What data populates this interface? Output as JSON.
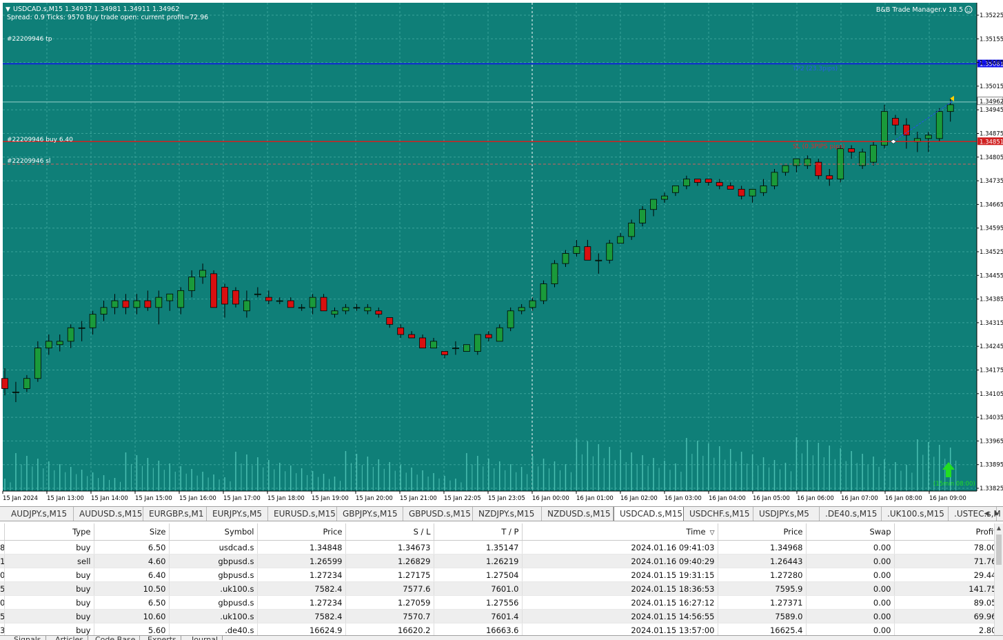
{
  "window": {
    "symbol_header": "USDCAD.s,M15  1.34937 1.34981 1.34911 1.34962",
    "info_line": "Spread: 0.9   Ticks: 9570   Buy trade open: current profit=72.96",
    "expert_label": "B&B Trade Manager.v 18.5"
  },
  "colors": {
    "chart_bg": "#0f7f78",
    "bull": "#1a9a3a",
    "bear": "#d81010",
    "tp_line": "#1010ee",
    "sl_line": "#d02020",
    "grid": "#3aa39a",
    "volume": "#4bbfb2"
  },
  "chart_labels": {
    "tp_order": "#22209946 tp",
    "buy_order": "#22209946 buy 6.40",
    "sl_order": "#22209946 sl",
    "tp_text": "TP2 (23.3pips)",
    "sl_text": "SL (0.3PIPS pips)",
    "countdown": "(15min 08:00)"
  },
  "chart_data": {
    "type": "candlestick",
    "price_axis_ticks": [
      "1.35225",
      "1.35155",
      "1.35085",
      "1.35015",
      "1.34945",
      "1.34875",
      "1.34805",
      "1.34735",
      "1.34665",
      "1.34595",
      "1.34525",
      "1.34455",
      "1.34385",
      "1.34315",
      "1.34245",
      "1.34175",
      "1.34105",
      "1.34035",
      "1.33965",
      "1.33895",
      "1.33825"
    ],
    "price_range": [
      1.3381,
      1.3527
    ],
    "time_axis_labels": [
      "15 Jan 2024",
      "15 Jan 13:00",
      "15 Jan 14:00",
      "15 Jan 15:00",
      "15 Jan 16:00",
      "15 Jan 17:00",
      "15 Jan 18:00",
      "15 Jan 19:00",
      "15 Jan 20:00",
      "15 Jan 21:00",
      "15 Jan 22:05",
      "15 Jan 23:05",
      "16 Jan 00:00",
      "16 Jan 01:00",
      "16 Jan 02:00",
      "16 Jan 03:00",
      "16 Jan 04:00",
      "16 Jan 05:00",
      "16 Jan 06:00",
      "16 Jan 07:00",
      "16 Jan 08:00",
      "16 Jan 09:00"
    ],
    "tp_price": 1.35081,
    "tp_price_label": "1.35081",
    "current_price": 1.34962,
    "current_price_label": "1.34962",
    "sl_price": 1.34851,
    "sl_price_label": "1.34851",
    "candles": [
      [
        1.3415,
        1.3418,
        1.341,
        1.3412
      ],
      [
        1.3411,
        1.3414,
        1.3408,
        1.3411
      ],
      [
        1.3412,
        1.3416,
        1.3411,
        1.3415
      ],
      [
        1.3415,
        1.3426,
        1.3414,
        1.3424
      ],
      [
        1.3424,
        1.3428,
        1.3422,
        1.3426
      ],
      [
        1.3425,
        1.3428,
        1.3423,
        1.3426
      ],
      [
        1.3426,
        1.3431,
        1.3424,
        1.343
      ],
      [
        1.343,
        1.3432,
        1.3426,
        1.343
      ],
      [
        1.343,
        1.3435,
        1.3428,
        1.3434
      ],
      [
        1.3434,
        1.3438,
        1.3432,
        1.3436
      ],
      [
        1.3436,
        1.344,
        1.3434,
        1.3438
      ],
      [
        1.3438,
        1.344,
        1.3434,
        1.3436
      ],
      [
        1.3436,
        1.344,
        1.3434,
        1.3438
      ],
      [
        1.3438,
        1.3441,
        1.3435,
        1.3436
      ],
      [
        1.3436,
        1.3441,
        1.3431,
        1.3439
      ],
      [
        1.3438,
        1.344,
        1.3435,
        1.344
      ],
      [
        1.3436,
        1.3442,
        1.3434,
        1.3441
      ],
      [
        1.3441,
        1.3447,
        1.3439,
        1.3445
      ],
      [
        1.3445,
        1.3449,
        1.3443,
        1.3447
      ],
      [
        1.3446,
        1.3447,
        1.3436,
        1.3436
      ],
      [
        1.3442,
        1.3443,
        1.3433,
        1.3437
      ],
      [
        1.3441,
        1.3442,
        1.3436,
        1.3437
      ],
      [
        1.3435,
        1.3441,
        1.3433,
        1.3438
      ],
      [
        1.344,
        1.3442,
        1.3439,
        1.344
      ],
      [
        1.3439,
        1.3441,
        1.3437,
        1.3438
      ],
      [
        1.3438,
        1.3439,
        1.3437,
        1.3438
      ],
      [
        1.3438,
        1.3439,
        1.3436,
        1.3436
      ],
      [
        1.3436,
        1.3437,
        1.3435,
        1.3436
      ],
      [
        1.3436,
        1.344,
        1.3434,
        1.3439
      ],
      [
        1.3439,
        1.344,
        1.3435,
        1.3435
      ],
      [
        1.3434,
        1.3436,
        1.3433,
        1.3435
      ],
      [
        1.3435,
        1.3437,
        1.3434,
        1.3436
      ],
      [
        1.3436,
        1.3437,
        1.3435,
        1.3436
      ],
      [
        1.3435,
        1.3437,
        1.3434,
        1.3436
      ],
      [
        1.3435,
        1.3436,
        1.3433,
        1.3434
      ],
      [
        1.3433,
        1.3433,
        1.343,
        1.3431
      ],
      [
        1.343,
        1.3431,
        1.3427,
        1.3428
      ],
      [
        1.3428,
        1.3429,
        1.3427,
        1.3427
      ],
      [
        1.3427,
        1.3428,
        1.3424,
        1.3424
      ],
      [
        1.3424,
        1.3427,
        1.3424,
        1.3426
      ],
      [
        1.3423,
        1.3423,
        1.3421,
        1.3422
      ],
      [
        1.3424,
        1.3426,
        1.3422,
        1.3424
      ],
      [
        1.3423,
        1.3425,
        1.3423,
        1.3425
      ],
      [
        1.3423,
        1.3428,
        1.3422,
        1.3428
      ],
      [
        1.3428,
        1.3429,
        1.3426,
        1.3427
      ],
      [
        1.3426,
        1.3431,
        1.3426,
        1.343
      ],
      [
        1.343,
        1.3436,
        1.3429,
        1.3435
      ],
      [
        1.3435,
        1.3437,
        1.3434,
        1.3436
      ],
      [
        1.3436,
        1.3439,
        1.3435,
        1.3438
      ],
      [
        1.3438,
        1.3444,
        1.3437,
        1.3443
      ],
      [
        1.3443,
        1.345,
        1.3442,
        1.3449
      ],
      [
        1.3449,
        1.3453,
        1.3448,
        1.3452
      ],
      [
        1.3452,
        1.3456,
        1.3451,
        1.3454
      ],
      [
        1.3454,
        1.3456,
        1.345,
        1.345
      ],
      [
        1.345,
        1.3452,
        1.3446,
        1.345
      ],
      [
        1.345,
        1.3456,
        1.3449,
        1.3455
      ],
      [
        1.3455,
        1.3458,
        1.3455,
        1.3457
      ],
      [
        1.3457,
        1.3462,
        1.3456,
        1.3461
      ],
      [
        1.3461,
        1.3466,
        1.346,
        1.3465
      ],
      [
        1.3465,
        1.3468,
        1.3463,
        1.3468
      ],
      [
        1.3468,
        1.347,
        1.3467,
        1.3469
      ],
      [
        1.347,
        1.3472,
        1.3469,
        1.3472
      ],
      [
        1.3472,
        1.3475,
        1.3471,
        1.3474
      ],
      [
        1.3474,
        1.3474,
        1.3472,
        1.3473
      ],
      [
        1.3474,
        1.3474,
        1.3472,
        1.3473
      ],
      [
        1.3473,
        1.3474,
        1.3471,
        1.3472
      ],
      [
        1.3472,
        1.3473,
        1.3471,
        1.3471
      ],
      [
        1.3471,
        1.3472,
        1.3468,
        1.3469
      ],
      [
        1.3469,
        1.3471,
        1.3467,
        1.3471
      ],
      [
        1.347,
        1.3474,
        1.3469,
        1.3472
      ],
      [
        1.3472,
        1.3477,
        1.3471,
        1.3476
      ],
      [
        1.3476,
        1.3478,
        1.3475,
        1.3478
      ],
      [
        1.3478,
        1.348,
        1.3476,
        1.348
      ],
      [
        1.3478,
        1.3481,
        1.3477,
        1.348
      ],
      [
        1.3479,
        1.348,
        1.3474,
        1.3475
      ],
      [
        1.3475,
        1.3477,
        1.3472,
        1.3474
      ],
      [
        1.3474,
        1.3484,
        1.3473,
        1.3483
      ],
      [
        1.3483,
        1.3484,
        1.348,
        1.3482
      ],
      [
        1.3478,
        1.3483,
        1.3477,
        1.3482
      ],
      [
        1.3479,
        1.3485,
        1.3478,
        1.3484
      ],
      [
        1.3484,
        1.3496,
        1.3483,
        1.3494
      ],
      [
        1.3492,
        1.3493,
        1.3487,
        1.349
      ],
      [
        1.349,
        1.3492,
        1.3483,
        1.3487
      ],
      [
        1.3485,
        1.3488,
        1.3482,
        1.3486
      ],
      [
        1.3486,
        1.3488,
        1.3482,
        1.3487
      ],
      [
        1.3486,
        1.3495,
        1.3485,
        1.3494
      ],
      [
        1.3494,
        1.3498,
        1.3491,
        1.3496
      ]
    ],
    "grid": true
  },
  "symbol_tabs": [
    "AUDJPY.s,M15",
    "AUDUSD.s,M15",
    "EURGBP.s,M1",
    "EURJPY.s,M5",
    "EURUSD.s,M15",
    "GBPJPY.s,M15",
    "GBPUSD.s,M15",
    "NZDJPY.s,M15",
    "NZDUSD.s,M15",
    "USDCAD.s,M15",
    "USDCHF.s,M15",
    "USDJPY.s,M5",
    ".DE40.s,M15",
    ".UK100.s,M15",
    ".USTEC.s,M"
  ],
  "active_tab": "USDCAD.s,M15",
  "tab_scroll": {
    "left": "◀",
    "right": "▶"
  },
  "trades": {
    "columns": [
      "Type",
      "Size",
      "Symbol",
      "Price",
      "S / L",
      "T / P",
      "Time",
      "Price",
      "Swap",
      "Profit"
    ],
    "sort_indicator": "▽",
    "rows": [
      {
        "id": "8",
        "type": "buy",
        "size": "6.50",
        "symbol": "usdcad.s",
        "price": "1.34848",
        "sl": "1.34673",
        "tp": "1.35147",
        "time": "2024.01.16 09:41:03",
        "cur": "1.34968",
        "swap": "0.00",
        "profit": "78.00"
      },
      {
        "id": "1",
        "type": "sell",
        "size": "4.60",
        "symbol": "gbpusd.s",
        "price": "1.26599",
        "sl": "1.26829",
        "tp": "1.26219",
        "time": "2024.01.16 09:40:29",
        "cur": "1.26443",
        "swap": "0.00",
        "profit": "71.76"
      },
      {
        "id": "0",
        "type": "buy",
        "size": "6.40",
        "symbol": "gbpusd.s",
        "price": "1.27234",
        "sl": "1.27175",
        "tp": "1.27504",
        "time": "2024.01.15 19:31:15",
        "cur": "1.27280",
        "swap": "0.00",
        "profit": "29.44"
      },
      {
        "id": "5",
        "type": "buy",
        "size": "10.50",
        "symbol": ".uk100.s",
        "price": "7582.4",
        "sl": "7577.6",
        "tp": "7601.0",
        "time": "2024.01.15 18:36:53",
        "cur": "7595.9",
        "swap": "0.00",
        "profit": "141.75"
      },
      {
        "id": "0",
        "type": "buy",
        "size": "6.50",
        "symbol": "gbpusd.s",
        "price": "1.27234",
        "sl": "1.27059",
        "tp": "1.27556",
        "time": "2024.01.15 16:27:12",
        "cur": "1.27371",
        "swap": "0.00",
        "profit": "89.05"
      },
      {
        "id": "5",
        "type": "buy",
        "size": "10.60",
        "symbol": ".uk100.s",
        "price": "7582.4",
        "sl": "7570.7",
        "tp": "7601.4",
        "time": "2024.01.15 14:56:55",
        "cur": "7589.0",
        "swap": "0.00",
        "profit": "69.96"
      },
      {
        "id": "3",
        "type": "buy",
        "size": "5.60",
        "symbol": ".de40.s",
        "price": "16624.9",
        "sl": "16620.2",
        "tp": "16663.6",
        "time": "2024.01.15 13:57:00",
        "cur": "16625.4",
        "swap": "0.00",
        "profit": "2.80"
      }
    ]
  },
  "bottom_tabs": [
    "Signals",
    "Articles",
    "Code Base",
    "Experts",
    "Journal"
  ]
}
